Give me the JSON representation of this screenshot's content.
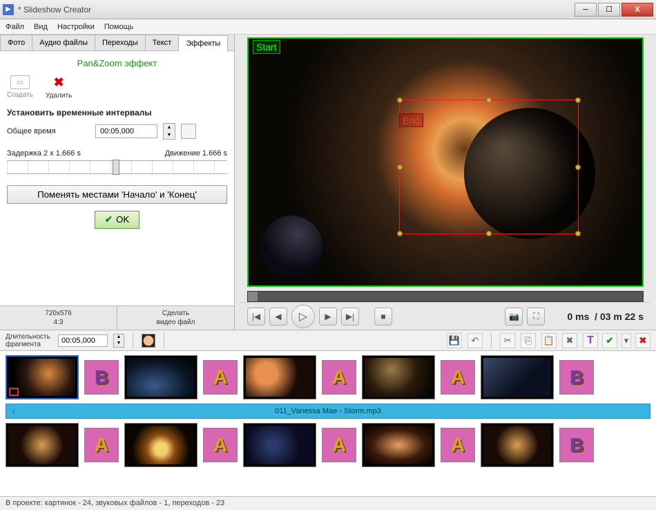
{
  "window": {
    "title": "* Slideshow Creator"
  },
  "menu": {
    "file": "Файл",
    "view": "Вид",
    "settings": "Настройки",
    "help": "Помощь"
  },
  "tabs": {
    "photo": "Фото",
    "audio": "Аудио файлы",
    "transitions": "Переходы",
    "text": "Текст",
    "effects": "Эффекты"
  },
  "panel": {
    "title": "Pan&Zoom эффект",
    "create": "Создать",
    "delete": "Удалить",
    "section": "Установить временные интервалы",
    "total_label": "Общее время",
    "total_value": "00:05,000",
    "delay_label": "Задержка 2 x 1.666 s",
    "motion_label": "Движение 1.666 s",
    "swap": "Поменять местами 'Начало' и 'Конец'",
    "ok": "OK"
  },
  "foot": {
    "res_line1": "720x576",
    "res_line2": "4:3",
    "make_line1": "Сделать",
    "make_line2": "видео файл"
  },
  "preview": {
    "start": "Start",
    "end": "End"
  },
  "playback": {
    "time_current": "0 ms",
    "time_sep": "/",
    "time_total": "03 m 22 s"
  },
  "timeline": {
    "dur_label": "Длительность фрагмента",
    "dur_value": "00:05,000",
    "audio_clip": "011_Vanessa Mae - Storm.mp3",
    "transitions_row1": [
      "B",
      "A",
      "A",
      "A",
      "B"
    ],
    "transitions_row2": [
      "A",
      "A",
      "A",
      "A",
      "B"
    ]
  },
  "status": "В проекте: картинок - 24, звуковых файлов - 1, переходов - 23"
}
